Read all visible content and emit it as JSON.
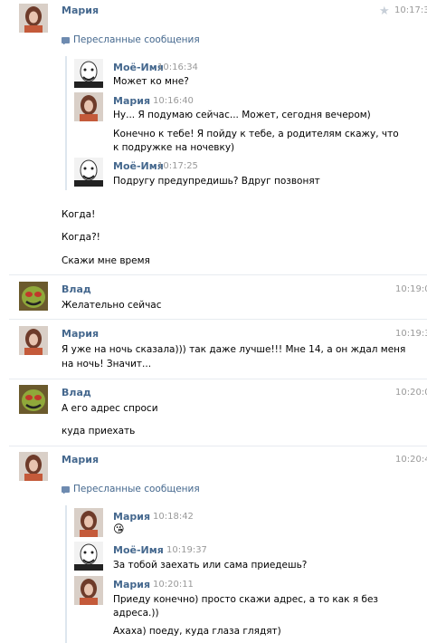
{
  "messages": [
    {
      "author": "Мария",
      "time": "10:17:3",
      "forwarded_label": "Пересланные сообщения",
      "forwarded": [
        {
          "author": "Моё-Имя",
          "time": "10:16:34",
          "lines": [
            "Может ко мне?"
          ]
        },
        {
          "author": "Мария",
          "time": "10:16:40",
          "lines": [
            "Ну... Я подумаю сейчас... Может, сегодня вечером)"
          ]
        },
        {
          "author": "",
          "time": "",
          "lines": [
            "Конечно к тебе! Я пойду к тебе, а родителям скажу, что",
            "к подружке на ночевку)"
          ]
        },
        {
          "author": "Моё-Имя",
          "time": "10:17:25",
          "lines": [
            "Подругу предупредишь? Вдруг позвонят"
          ]
        }
      ],
      "extra_lines": [
        "Когда!",
        "Когда?!",
        "Скажи мне время"
      ]
    },
    {
      "author": "Влад",
      "time": "10:19:0",
      "lines": [
        "Желательно сейчас"
      ]
    },
    {
      "author": "Мария",
      "time": "10:19:3",
      "lines": [
        "Я уже на ночь сказала))) так даже лучше!!! Мне 14, а он ждал меня",
        "на ночь! Значит..."
      ]
    },
    {
      "author": "Влад",
      "time": "10:20:0",
      "lines": [
        "А его адрес спроси",
        "куда приехать"
      ]
    },
    {
      "author": "Мария",
      "time": "10:20:4",
      "forwarded_label": "Пересланные сообщения",
      "forwarded": [
        {
          "author": "Мария",
          "time": "10:18:42",
          "lines": [
            "😘"
          ]
        },
        {
          "author": "Моё-Имя",
          "time": "10:19:37",
          "lines": [
            "За тобой заехать или сама приедешь?"
          ]
        },
        {
          "author": "Мария",
          "time": "10:20:11",
          "lines": [
            "Приеду конечно) просто скажи адрес, а то как я без",
            "адреса.))"
          ]
        },
        {
          "author": "",
          "time": "",
          "lines": [
            "Ахаха) поеду, куда глаза глядят)"
          ]
        }
      ]
    }
  ]
}
